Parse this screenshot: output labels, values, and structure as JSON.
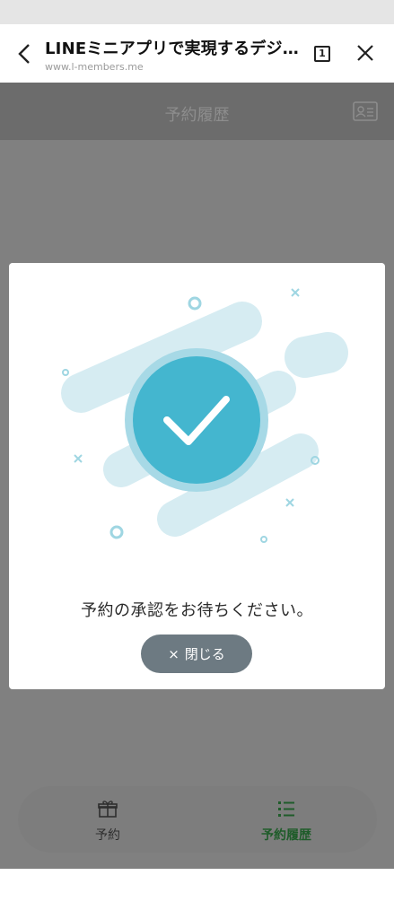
{
  "browser": {
    "title": "LINEミニアプリで実現するデジ…",
    "url": "www.l-members.me",
    "tab_count": "1"
  },
  "app": {
    "title": "予約履歴"
  },
  "dialog": {
    "message": "予約の承認をお待ちください。",
    "close_icon": "×",
    "close_label": "閉じる"
  },
  "bottom_nav": {
    "items": [
      {
        "label": "予約",
        "icon": "gift-icon",
        "active": false
      },
      {
        "label": "予約履歴",
        "icon": "list-icon",
        "active": true
      }
    ]
  },
  "colors": {
    "check_circle": "#44b6cf",
    "deco": "#d6ecf2",
    "active_nav": "#1f5c2a"
  }
}
